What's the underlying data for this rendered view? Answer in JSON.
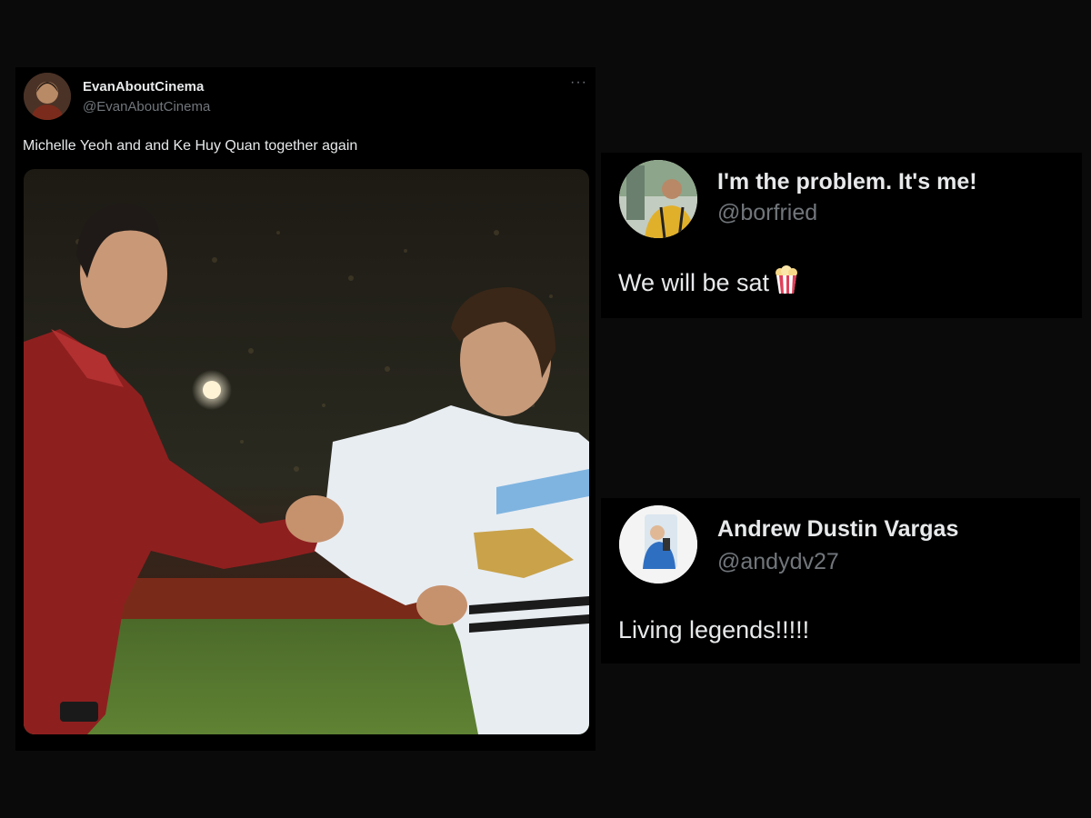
{
  "main_tweet": {
    "author_name": "EvanAboutCinema",
    "handle": "@EvanAboutCinema",
    "text": "Michelle Yeoh and and Ke Huy Quan together again",
    "more_label": "···",
    "media_icon": "photo-handshake"
  },
  "replies": [
    {
      "author_name": "I'm the problem. It's me!",
      "handle": "@borfried",
      "text": "We will be sat",
      "emoji_icon": "popcorn-icon"
    },
    {
      "author_name": "Andrew Dustin Vargas",
      "handle": "@andydv27",
      "text": "Living legends!!!!!"
    }
  ],
  "colors": {
    "background": "#0a0a0b",
    "card": "#000000",
    "primary_text": "#e7e9ea",
    "secondary_text": "#71767b"
  }
}
